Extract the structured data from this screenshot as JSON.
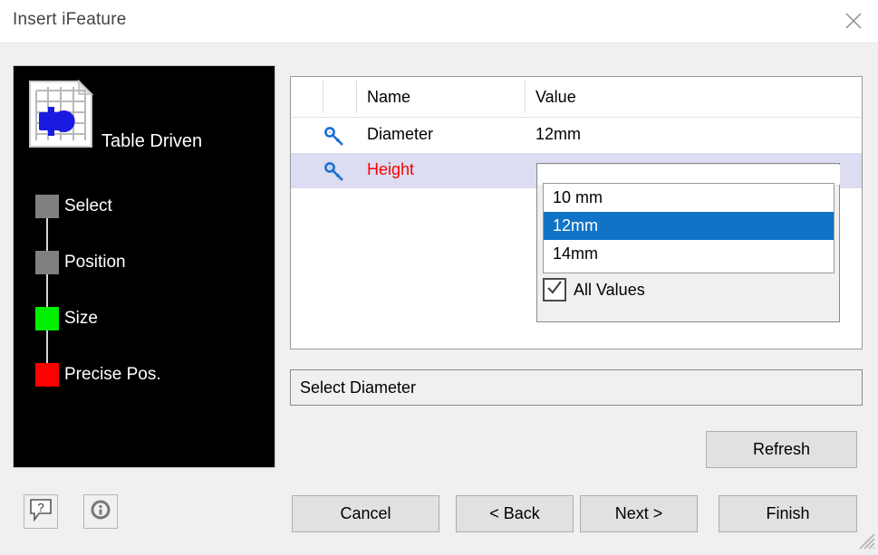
{
  "window": {
    "title": "Insert iFeature",
    "close_icon": "close-icon",
    "resize_grip_icon": "resize-grip-icon"
  },
  "wizard": {
    "icon_name": "table-driven-ifeature-icon",
    "icon_title": "Table Driven",
    "steps": [
      {
        "label": "Select",
        "color": "#808080"
      },
      {
        "label": "Position",
        "color": "#808080"
      },
      {
        "label": "Size",
        "color": "#00ee00"
      },
      {
        "label": "Precise Pos.",
        "color": "#ff0000"
      }
    ]
  },
  "toolbar": {
    "help_icon": "help-balloon-icon",
    "help_glyph": "?",
    "info_icon": "info-icon",
    "info_glyph": "i"
  },
  "grid": {
    "columns": [
      "Name",
      "Value"
    ],
    "rows": [
      {
        "icon": "key-icon",
        "name": "Diameter",
        "value": "12mm",
        "error": false,
        "selected": false
      },
      {
        "icon": "key-icon",
        "name": "Height",
        "value": "",
        "error": true,
        "selected": true
      }
    ]
  },
  "combo": {
    "edit_value": "",
    "options": [
      "10 mm",
      "12mm",
      "14mm"
    ],
    "selected_index": 1,
    "all_values_label": "All Values",
    "all_values_checked": true,
    "check_glyph": "check-icon"
  },
  "status": {
    "text": "Select Diameter"
  },
  "buttons": {
    "refresh": "Refresh",
    "cancel": "Cancel",
    "back": "< Back",
    "next": "Next >",
    "finish": "Finish"
  }
}
